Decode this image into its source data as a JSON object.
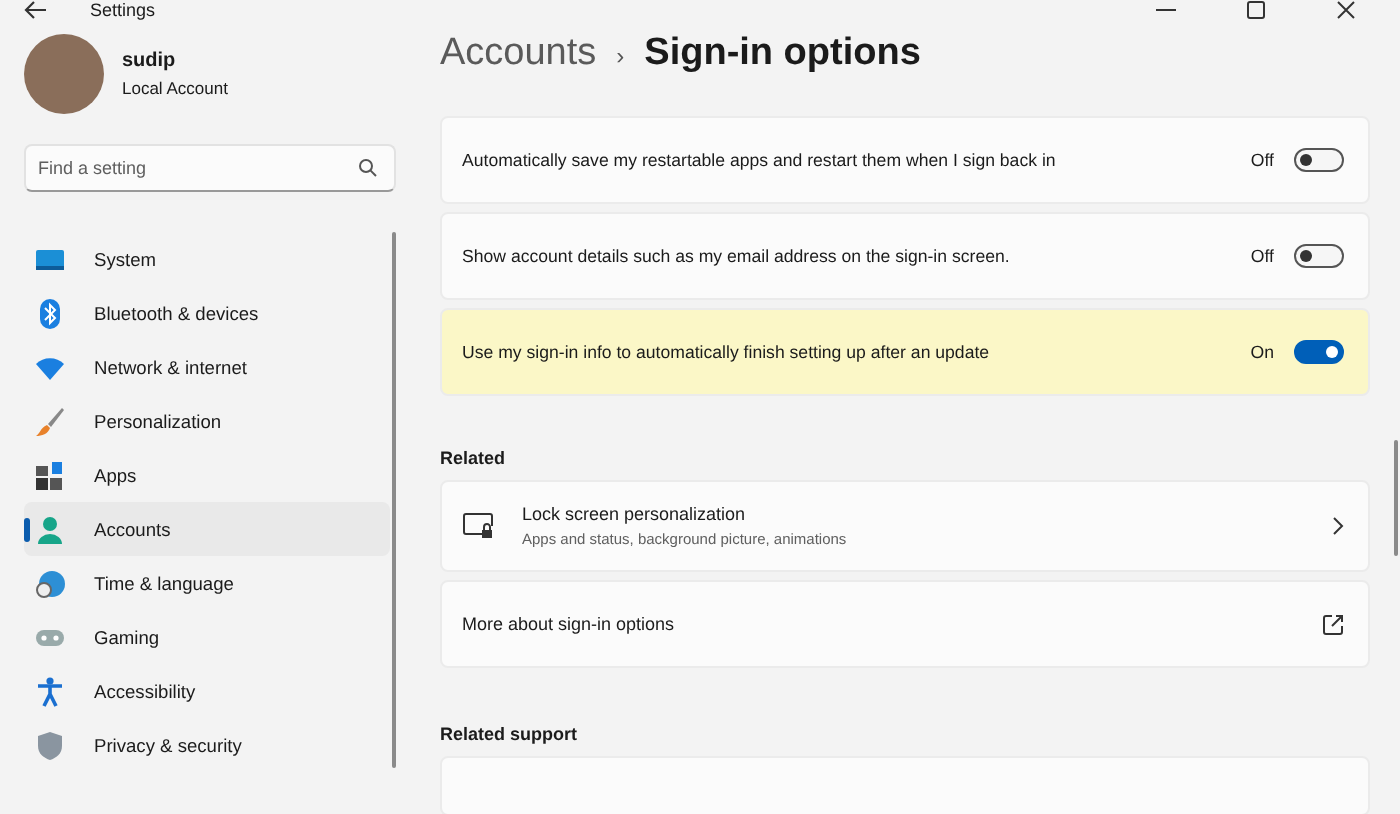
{
  "window": {
    "title": "Settings"
  },
  "profile": {
    "name": "sudip",
    "account_type": "Local Account"
  },
  "search": {
    "placeholder": "Find a setting"
  },
  "nav": [
    {
      "label": "System",
      "kind": "system",
      "selected": false
    },
    {
      "label": "Bluetooth & devices",
      "kind": "bluetooth",
      "selected": false
    },
    {
      "label": "Network & internet",
      "kind": "network",
      "selected": false
    },
    {
      "label": "Personalization",
      "kind": "brush",
      "selected": false
    },
    {
      "label": "Apps",
      "kind": "apps",
      "selected": false
    },
    {
      "label": "Accounts",
      "kind": "accounts",
      "selected": true
    },
    {
      "label": "Time & language",
      "kind": "time",
      "selected": false
    },
    {
      "label": "Gaming",
      "kind": "gaming",
      "selected": false
    },
    {
      "label": "Accessibility",
      "kind": "accessibility",
      "selected": false
    },
    {
      "label": "Privacy & security",
      "kind": "privacy",
      "selected": false
    }
  ],
  "breadcrumb": {
    "parent": "Accounts",
    "separator": "›",
    "current": "Sign-in options"
  },
  "settings": [
    {
      "label": "Automatically save my restartable apps and restart them when I sign back in",
      "state_text": "Off",
      "on": false,
      "highlighted": false
    },
    {
      "label": "Show account details such as my email address on the sign-in screen.",
      "state_text": "Off",
      "on": false,
      "highlighted": false
    },
    {
      "label": "Use my sign-in info to automatically finish setting up after an update",
      "state_text": "On",
      "on": true,
      "highlighted": true
    }
  ],
  "related": {
    "heading": "Related",
    "items": [
      {
        "kind": "nav",
        "title": "Lock screen personalization",
        "subtitle": "Apps and status, background picture, animations"
      },
      {
        "kind": "external",
        "title": "More about sign-in options"
      }
    ]
  },
  "related_support": {
    "heading": "Related support"
  }
}
